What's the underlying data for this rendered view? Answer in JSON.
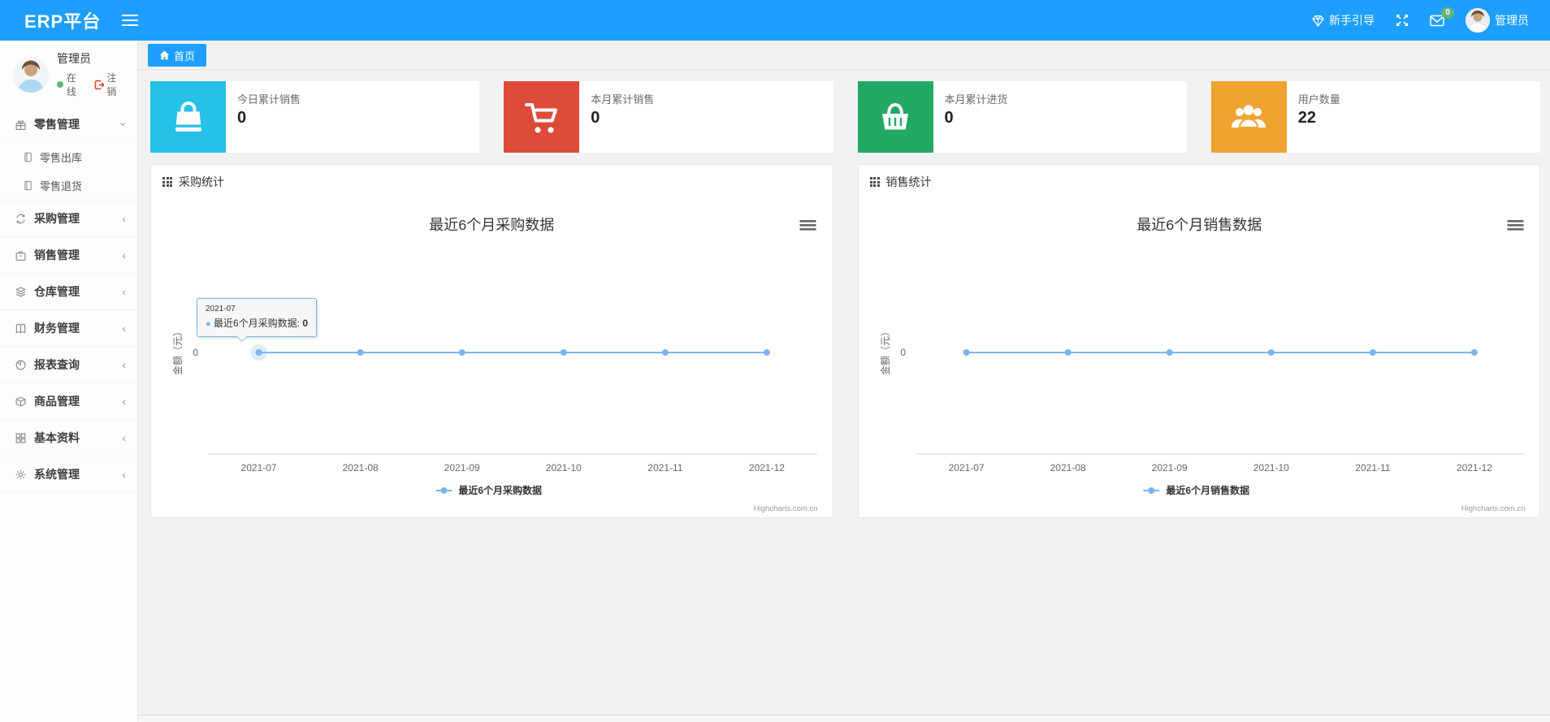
{
  "navbar": {
    "brand": "ERP平台",
    "guide_label": "新手引导",
    "message_badge": "0",
    "username": "管理员"
  },
  "sidebar": {
    "user": {
      "name": "管理员",
      "status": "在线",
      "logout_label": "注销"
    },
    "items": [
      {
        "label": "零售管理",
        "icon": "gift-icon",
        "expanded": true,
        "children": [
          "零售出库",
          "零售退货"
        ]
      },
      {
        "label": "采购管理",
        "icon": "refresh-icon"
      },
      {
        "label": "销售管理",
        "icon": "briefcase-icon"
      },
      {
        "label": "仓库管理",
        "icon": "layers-icon"
      },
      {
        "label": "财务管理",
        "icon": "book-icon"
      },
      {
        "label": "报表查询",
        "icon": "pie-chart-icon"
      },
      {
        "label": "商品管理",
        "icon": "cube-icon"
      },
      {
        "label": "基本资料",
        "icon": "grid-icon"
      },
      {
        "label": "系统管理",
        "icon": "gear-icon"
      }
    ],
    "chevron_expanded": "›",
    "chevron_collapsed": "‹"
  },
  "breadcrumb": {
    "home_label": "首页"
  },
  "stat_cards": [
    {
      "label": "今日累计销售",
      "value": "0",
      "color": "#26c0e8",
      "icon": "shopping-bag-icon"
    },
    {
      "label": "本月累计销售",
      "value": "0",
      "color": "#dd4b39",
      "icon": "cart-icon"
    },
    {
      "label": "本月累计进货",
      "value": "0",
      "color": "#23a863",
      "icon": "basket-icon"
    },
    {
      "label": "用户数量",
      "value": "22",
      "color": "#f0a330",
      "icon": "users-icon"
    }
  ],
  "panels": [
    {
      "header": "采购统计"
    },
    {
      "header": "销售统计"
    }
  ],
  "chart_data": [
    {
      "type": "line",
      "title": "最近6个月采购数据",
      "categories": [
        "2021-07",
        "2021-08",
        "2021-09",
        "2021-10",
        "2021-11",
        "2021-12"
      ],
      "series": [
        {
          "name": "最近6个月采购数据",
          "values": [
            0,
            0,
            0,
            0,
            0,
            0
          ],
          "color": "#7cb5ec"
        }
      ],
      "xlabel": "",
      "ylabel": "金额（元）",
      "yticks": [
        "0"
      ],
      "ylim": [
        0,
        1
      ],
      "grid": false,
      "legend_position": "bottom",
      "credits": "Highcharts.com.cn",
      "tooltip": {
        "header": "2021-07",
        "series": "最近6个月采购数据",
        "value": "0",
        "point_index": 0
      }
    },
    {
      "type": "line",
      "title": "最近6个月销售数据",
      "categories": [
        "2021-07",
        "2021-08",
        "2021-09",
        "2021-10",
        "2021-11",
        "2021-12"
      ],
      "series": [
        {
          "name": "最近6个月销售数据",
          "values": [
            0,
            0,
            0,
            0,
            0,
            0
          ],
          "color": "#7cb5ec"
        }
      ],
      "xlabel": "",
      "ylabel": "金额（元）",
      "yticks": [
        "0"
      ],
      "ylim": [
        0,
        1
      ],
      "grid": false,
      "legend_position": "bottom",
      "credits": "Highcharts.com.cn"
    }
  ]
}
